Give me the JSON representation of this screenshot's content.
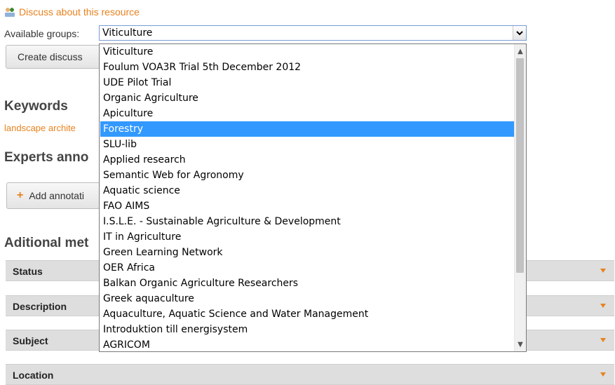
{
  "discuss": {
    "label": "Discuss about this resource",
    "icon": "group-users-icon"
  },
  "groups": {
    "label": "Available groups:",
    "selected": "Viticulture",
    "options": [
      "Viticulture",
      "Foulum VOA3R Trial 5th December 2012",
      "UDE Pilot Trial",
      "Organic Agriculture",
      "Apiculture",
      "Forestry",
      "SLU-lib",
      "Applied research",
      "Semantic Web for Agronomy",
      "Aquatic science",
      "FAO AIMS",
      "I.S.L.E. - Sustainable Agriculture & Development",
      "IT in Agriculture",
      "Green Learning Network",
      "OER Africa",
      "Balkan Organic Agriculture Researchers",
      "Greek aquaculture",
      "Aquaculture, Aquatic Science and Water Management",
      "Introduktion till energisystem",
      "AGRICOM"
    ],
    "highlighted": "Forestry"
  },
  "buttons": {
    "create_discussion": "Create discuss",
    "add_annotation": "Add annotati"
  },
  "sections": {
    "keywords": "Keywords",
    "keyword_link": "landscape archite",
    "experts": "Experts anno",
    "additional": "Aditional met"
  },
  "meta_bars": [
    "Status",
    "Description",
    "Subject",
    "Location"
  ],
  "colors": {
    "accent": "#e8821e",
    "highlight": "#3399ff",
    "bar": "#dedede"
  }
}
